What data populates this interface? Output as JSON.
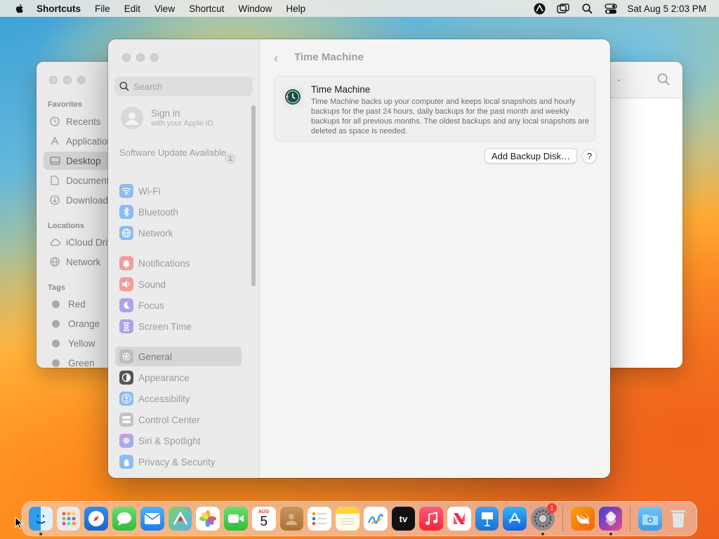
{
  "menubar": {
    "app_name": "Shortcuts",
    "items": [
      "File",
      "Edit",
      "View",
      "Shortcut",
      "Window",
      "Help"
    ],
    "clock": "Sat Aug 5  2:03 PM"
  },
  "finder": {
    "sections": {
      "favorites": "Favorites",
      "locations": "Locations",
      "tags": "Tags"
    },
    "favorites": [
      "Recents",
      "Applications",
      "Desktop",
      "Documents",
      "Downloads"
    ],
    "locations": [
      "iCloud Drive",
      "Network"
    ],
    "tags": [
      "Red",
      "Orange",
      "Yellow",
      "Green"
    ]
  },
  "settings": {
    "search_placeholder": "Search",
    "signin": {
      "title": "Sign in",
      "subtitle": "with your Apple ID"
    },
    "software_update": {
      "label": "Software Update Available",
      "count": "1"
    },
    "items": [
      {
        "label": "Wi-Fi",
        "icon": "wifi-icon",
        "color": "#7fb4f3"
      },
      {
        "label": "Bluetooth",
        "icon": "bluetooth-icon",
        "color": "#7fb4f3"
      },
      {
        "label": "Network",
        "icon": "globe-icon",
        "color": "#7fb4f3"
      },
      {
        "label": "Notifications",
        "icon": "bell-icon",
        "color": "#f39a9a"
      },
      {
        "label": "Sound",
        "icon": "speaker-icon",
        "color": "#f39a9a"
      },
      {
        "label": "Focus",
        "icon": "moon-icon",
        "color": "#a99de9"
      },
      {
        "label": "Screen Time",
        "icon": "hourglass-icon",
        "color": "#a99de9"
      },
      {
        "label": "General",
        "icon": "gear-icon",
        "color": "#b9b9b9"
      },
      {
        "label": "Appearance",
        "icon": "appearance-icon",
        "color": "#555555"
      },
      {
        "label": "Accessibility",
        "icon": "accessibility-icon",
        "color": "#7fb4f3"
      },
      {
        "label": "Control Center",
        "icon": "control-center-icon",
        "color": "#bdbdbd"
      },
      {
        "label": "Siri & Spotlight",
        "icon": "siri-icon",
        "color": "#c597e6"
      },
      {
        "label": "Privacy & Security",
        "icon": "hand-icon",
        "color": "#7fb4f3"
      }
    ],
    "selected": "General",
    "pane": {
      "title": "Time Machine",
      "card_title": "Time Machine",
      "card_desc": "Time Machine backs up your computer and keeps local snapshots and hourly backups for the past 24 hours, daily backups for the past month and weekly backups for all previous months. The oldest backups and any local snapshots are deleted as space is needed.",
      "add_button": "Add Backup Disk…",
      "help": "?"
    }
  },
  "dock": {
    "calendar_month": "AUG",
    "calendar_day": "5",
    "tv_label": "tv",
    "settings_badge": "1"
  }
}
